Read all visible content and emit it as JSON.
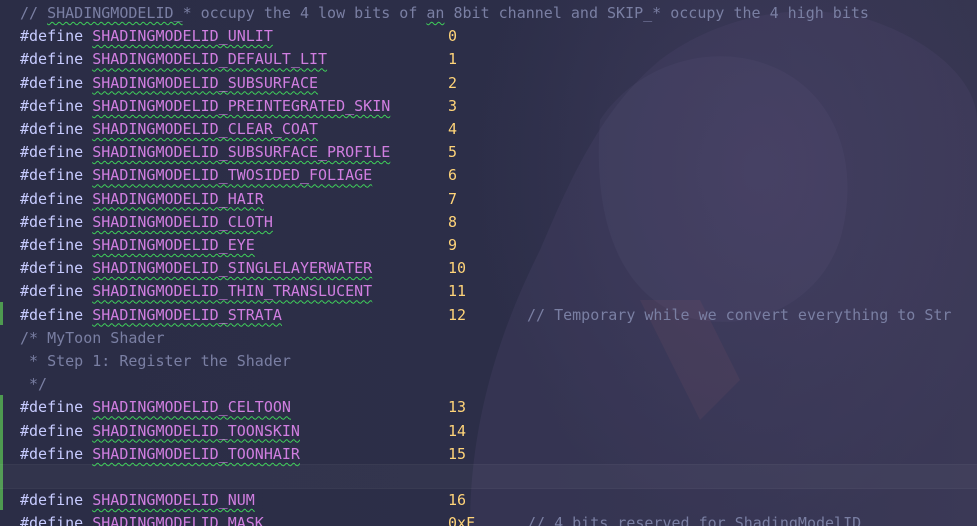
{
  "header_comment": {
    "prefix": "// ",
    "word1": "SHADINGMODELID_",
    "mid1": "* occupy the 4 low bits of ",
    "word2": "an",
    "mid2": " 8bit channel and SKIP_* occupy the 4 high bits"
  },
  "directive": "#define",
  "defines": [
    {
      "name": "SHADINGMODELID_UNLIT",
      "value": "0"
    },
    {
      "name": "SHADINGMODELID_DEFAULT_LIT",
      "value": "1"
    },
    {
      "name": "SHADINGMODELID_SUBSURFACE",
      "value": "2"
    },
    {
      "name": "SHADINGMODELID_PREINTEGRATED_SKIN",
      "value": "3"
    },
    {
      "name": "SHADINGMODELID_CLEAR_COAT",
      "value": "4"
    },
    {
      "name": "SHADINGMODELID_SUBSURFACE_PROFILE",
      "value": "5"
    },
    {
      "name": "SHADINGMODELID_TWOSIDED_FOLIAGE",
      "value": "6"
    },
    {
      "name": "SHADINGMODELID_HAIR",
      "value": "7"
    },
    {
      "name": "SHADINGMODELID_CLOTH",
      "value": "8"
    },
    {
      "name": "SHADINGMODELID_EYE",
      "value": "9"
    },
    {
      "name": "SHADINGMODELID_SINGLELAYERWATER",
      "value": "10"
    },
    {
      "name": "SHADINGMODELID_THIN_TRANSLUCENT",
      "value": "11"
    },
    {
      "name": "SHADINGMODELID_STRATA",
      "value": "12",
      "comment": "// Temporary while we convert everything to Str"
    }
  ],
  "block_comment": [
    "/* MyToon Shader",
    " * Step 1: Register the Shader",
    " */"
  ],
  "custom_defines": [
    {
      "name": "SHADINGMODELID_CELTOON",
      "value": "13"
    },
    {
      "name": "SHADINGMODELID_TOONSKIN",
      "value": "14"
    },
    {
      "name": "SHADINGMODELID_TOONHAIR",
      "value": "15"
    }
  ],
  "tail_defines": [
    {
      "name": "SHADINGMODELID_NUM",
      "value": "16"
    },
    {
      "name": "SHADINGMODELID_MASK",
      "value": "0xF",
      "comment": "// 4 bits reserved for ShadingModelID"
    }
  ],
  "colors": {
    "background": "#2a2c44",
    "macro": "#d07ee0",
    "number": "#ffd479",
    "comment": "#7a7fa3",
    "squiggle": "#3fcf5a",
    "gutter_modified": "#4e9a50"
  }
}
